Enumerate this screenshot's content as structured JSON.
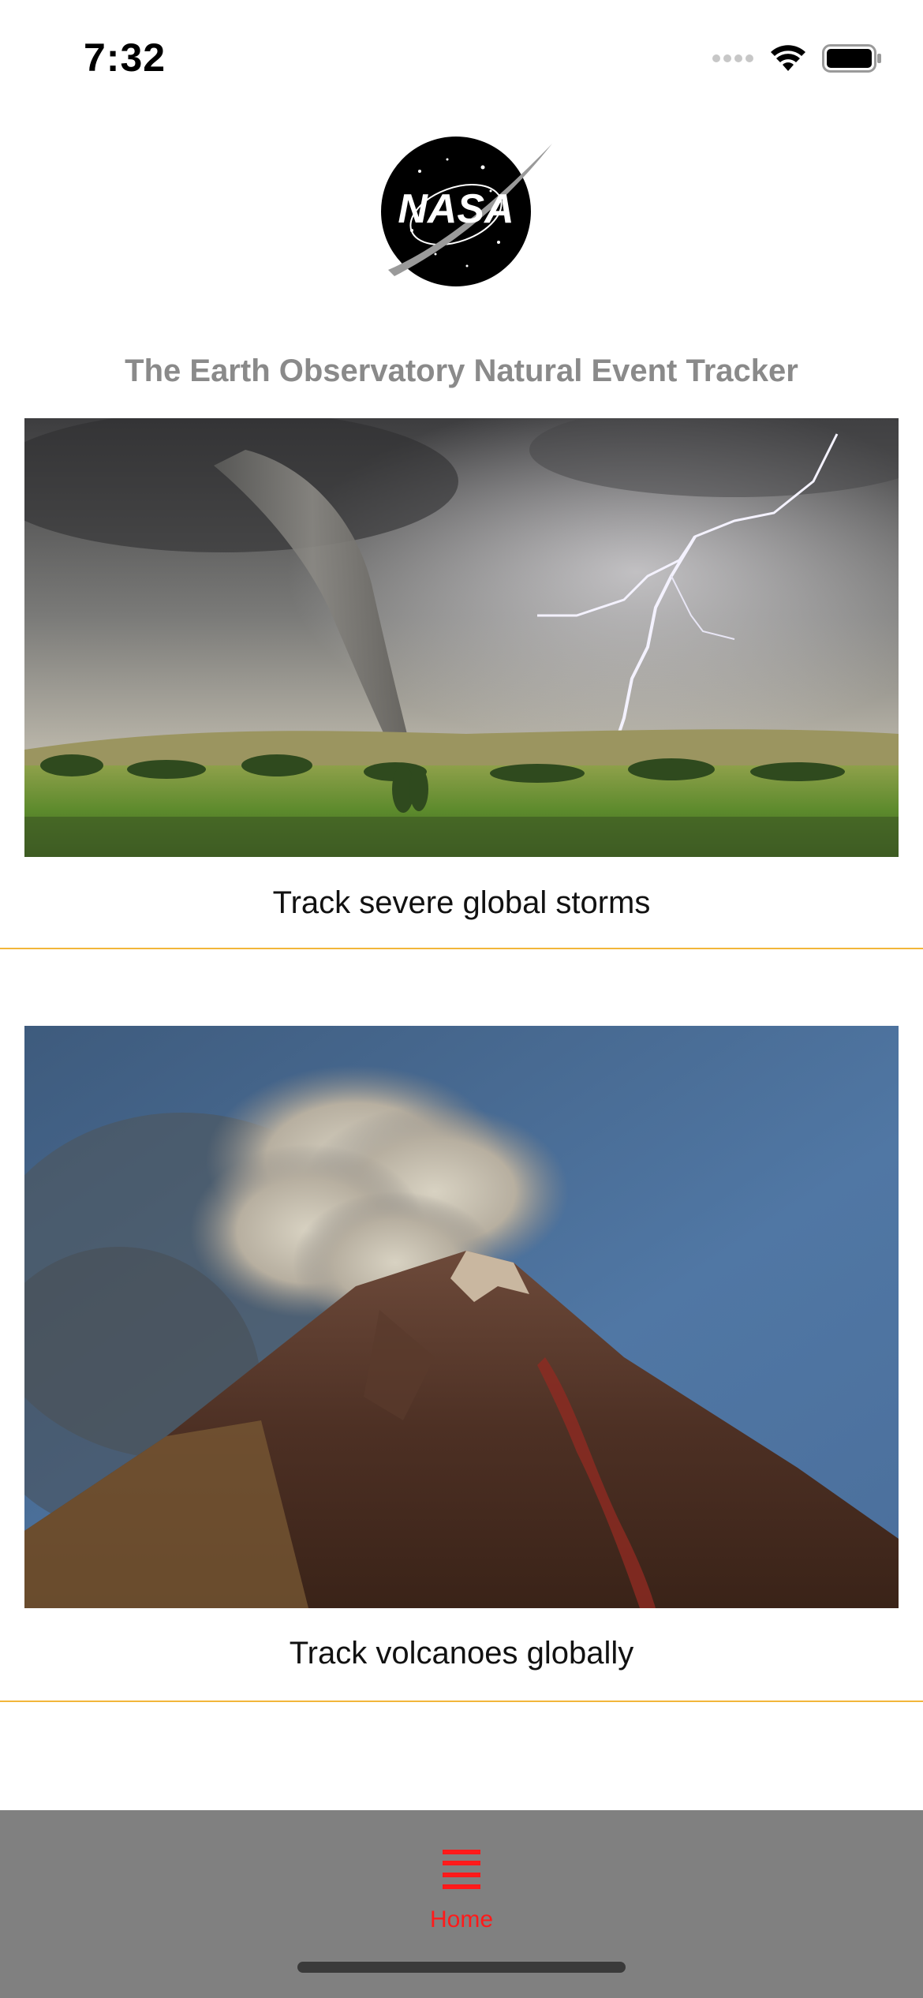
{
  "status_bar": {
    "time": "7:32",
    "icons": [
      "signal-icon",
      "wifi-icon",
      "battery-icon"
    ]
  },
  "header": {
    "logo_text": "NASA",
    "title": "The Earth Observatory Natural Event Tracker"
  },
  "cards": [
    {
      "caption": "Track severe global storms",
      "image": "tornado-lightning-photo"
    },
    {
      "caption": "Track volcanoes globally",
      "image": "erupting-volcano-photo"
    }
  ],
  "tab_bar": {
    "items": [
      {
        "label": "Home",
        "icon": "menu-lines-icon",
        "selected": true
      }
    ]
  },
  "colors": {
    "title_gray": "#8a8a8a",
    "divider_orange": "#f2b63a",
    "tab_bar_bg": "#808080",
    "tab_active_red": "#ff1a1a"
  }
}
